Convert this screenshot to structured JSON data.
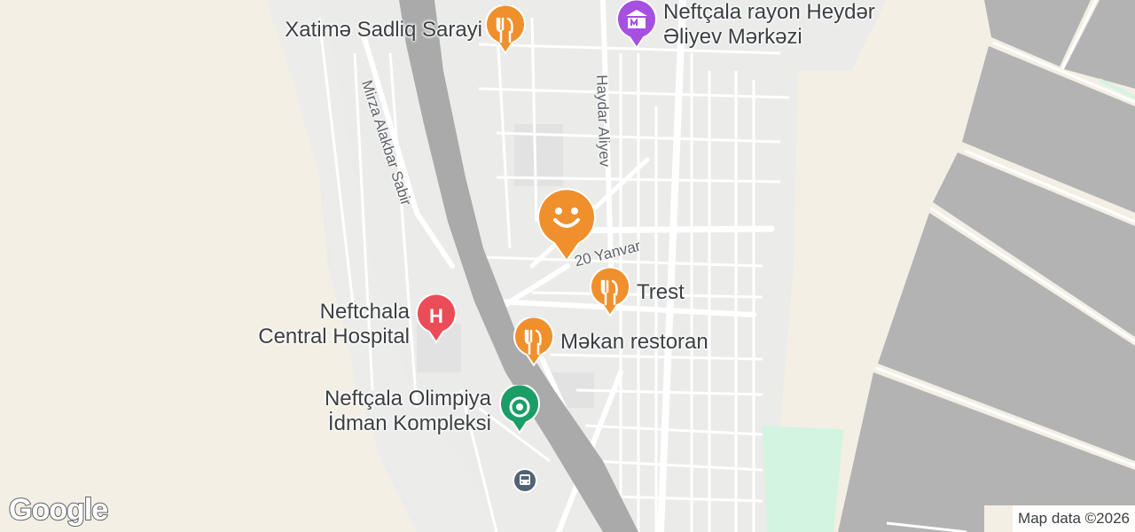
{
  "map": {
    "colors": {
      "land": "#f3efe5",
      "urban": "#ebebea",
      "road": "#ffffff",
      "river": "#aaaaaa",
      "field": "#b3b3b3",
      "park": "#d3f4e1",
      "food_pin": "#f0902c",
      "hospital_pin": "#ea4d57",
      "sport_pin": "#1b9e66",
      "civic_pin": "#a64fe0",
      "transit_pin": "#4f6373"
    },
    "pois": [
      {
        "id": "xatime",
        "label": "Xatimə Sadliq Sarayi",
        "icon": "fork-knife-icon"
      },
      {
        "id": "heydar-center",
        "label_lines": [
          "Neftçala rayon Heydər",
          "Əliyev Mərkəzi"
        ],
        "icon": "museum-icon"
      },
      {
        "id": "trest",
        "label": "Trest",
        "icon": "fork-knife-icon"
      },
      {
        "id": "mekan",
        "label": "Məkan restoran",
        "icon": "fork-knife-icon"
      },
      {
        "id": "hospital",
        "label_lines": [
          "Neftchala",
          "Central Hospital"
        ],
        "icon": "hospital-icon",
        "glyph": "H"
      },
      {
        "id": "olimpiya",
        "label_lines": [
          "Neftçala Olimpiya",
          "İdman Kompleksi"
        ],
        "icon": "stadium-icon"
      },
      {
        "id": "bus",
        "icon": "bus-icon"
      }
    ],
    "streets": [
      {
        "id": "mirza",
        "label": "Mirza Alakbar Sabir"
      },
      {
        "id": "haydar",
        "label": "Haydar Aliyev"
      },
      {
        "id": "yanvar",
        "label": "20 Yanvar"
      }
    ],
    "marker": {
      "icon": "smiley-marker-icon"
    },
    "logo": "Google",
    "attribution": "Map data ©2026"
  }
}
